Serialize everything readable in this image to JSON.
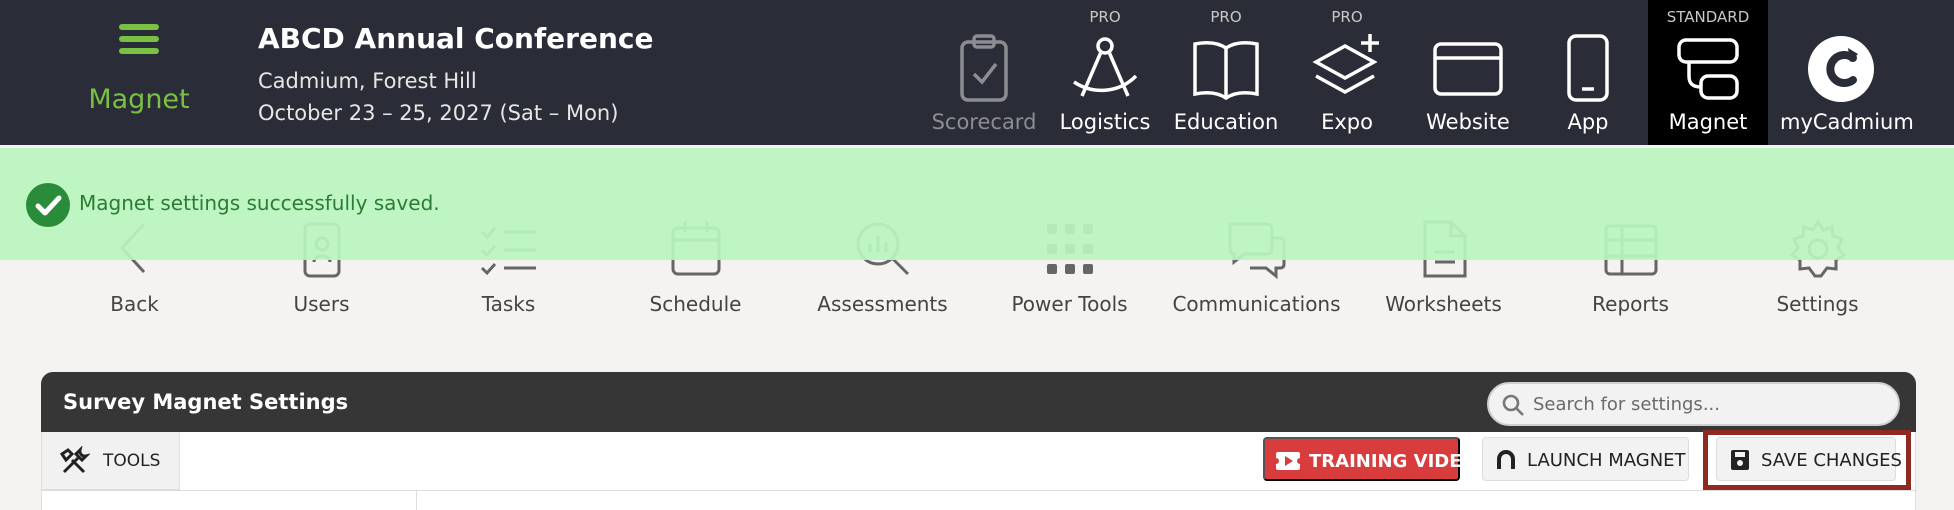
{
  "brand": {
    "name": "Magnet",
    "color": "#79c043",
    "icon": "hamburger-menu-icon"
  },
  "event": {
    "title": "ABCD Annual Conference",
    "location": "Cadmium, Forest Hill",
    "dates": "October 23 – 25, 2027 (Sat – Mon)"
  },
  "topnav": [
    {
      "label": "Scorecard",
      "tier": "",
      "icon": "clipboard-check-icon",
      "state": "disabled"
    },
    {
      "label": "Logistics",
      "tier": "PRO",
      "icon": "compass-icon",
      "state": "normal"
    },
    {
      "label": "Education",
      "tier": "PRO",
      "icon": "open-book-icon",
      "state": "normal"
    },
    {
      "label": "Expo",
      "tier": "PRO",
      "icon": "layers-plus-icon",
      "state": "normal"
    },
    {
      "label": "Website",
      "tier": "",
      "icon": "browser-window-icon",
      "state": "normal"
    },
    {
      "label": "App",
      "tier": "",
      "icon": "smartphone-icon",
      "state": "normal"
    },
    {
      "label": "Magnet",
      "tier": "STANDARD",
      "icon": "magnet-app-icon",
      "state": "active"
    },
    {
      "label": "myCadmium",
      "tier": "",
      "icon": "cadmium-logo-icon",
      "state": "normal"
    }
  ],
  "toast": {
    "message": "Magnet settings successfully saved.",
    "icon": "check-circle-icon",
    "color": "#2a7d32"
  },
  "subnav": [
    {
      "label": "Back",
      "icon": "chevron-left-icon"
    },
    {
      "label": "Users",
      "icon": "user-badge-icon"
    },
    {
      "label": "Tasks",
      "icon": "checklist-icon"
    },
    {
      "label": "Schedule",
      "icon": "calendar-icon"
    },
    {
      "label": "Assessments",
      "icon": "chart-search-icon"
    },
    {
      "label": "Power Tools",
      "icon": "grid-dots-icon"
    },
    {
      "label": "Communications",
      "icon": "chat-bubbles-icon"
    },
    {
      "label": "Worksheets",
      "icon": "document-icon"
    },
    {
      "label": "Reports",
      "icon": "table-report-icon"
    },
    {
      "label": "Settings",
      "icon": "gear-icon"
    }
  ],
  "panel": {
    "title": "Survey Magnet Settings",
    "search_placeholder": "Search for settings...",
    "tools_label": "TOOLS",
    "training_label": "TRAINING VIDEO",
    "launch_label": "LAUNCH MAGNET",
    "save_label": "SAVE CHANGES"
  },
  "colors": {
    "topbar": "#2a2d37",
    "toast_bg": "#b9f4be",
    "training": "#d83c3c",
    "highlight": "#8f2a21"
  }
}
